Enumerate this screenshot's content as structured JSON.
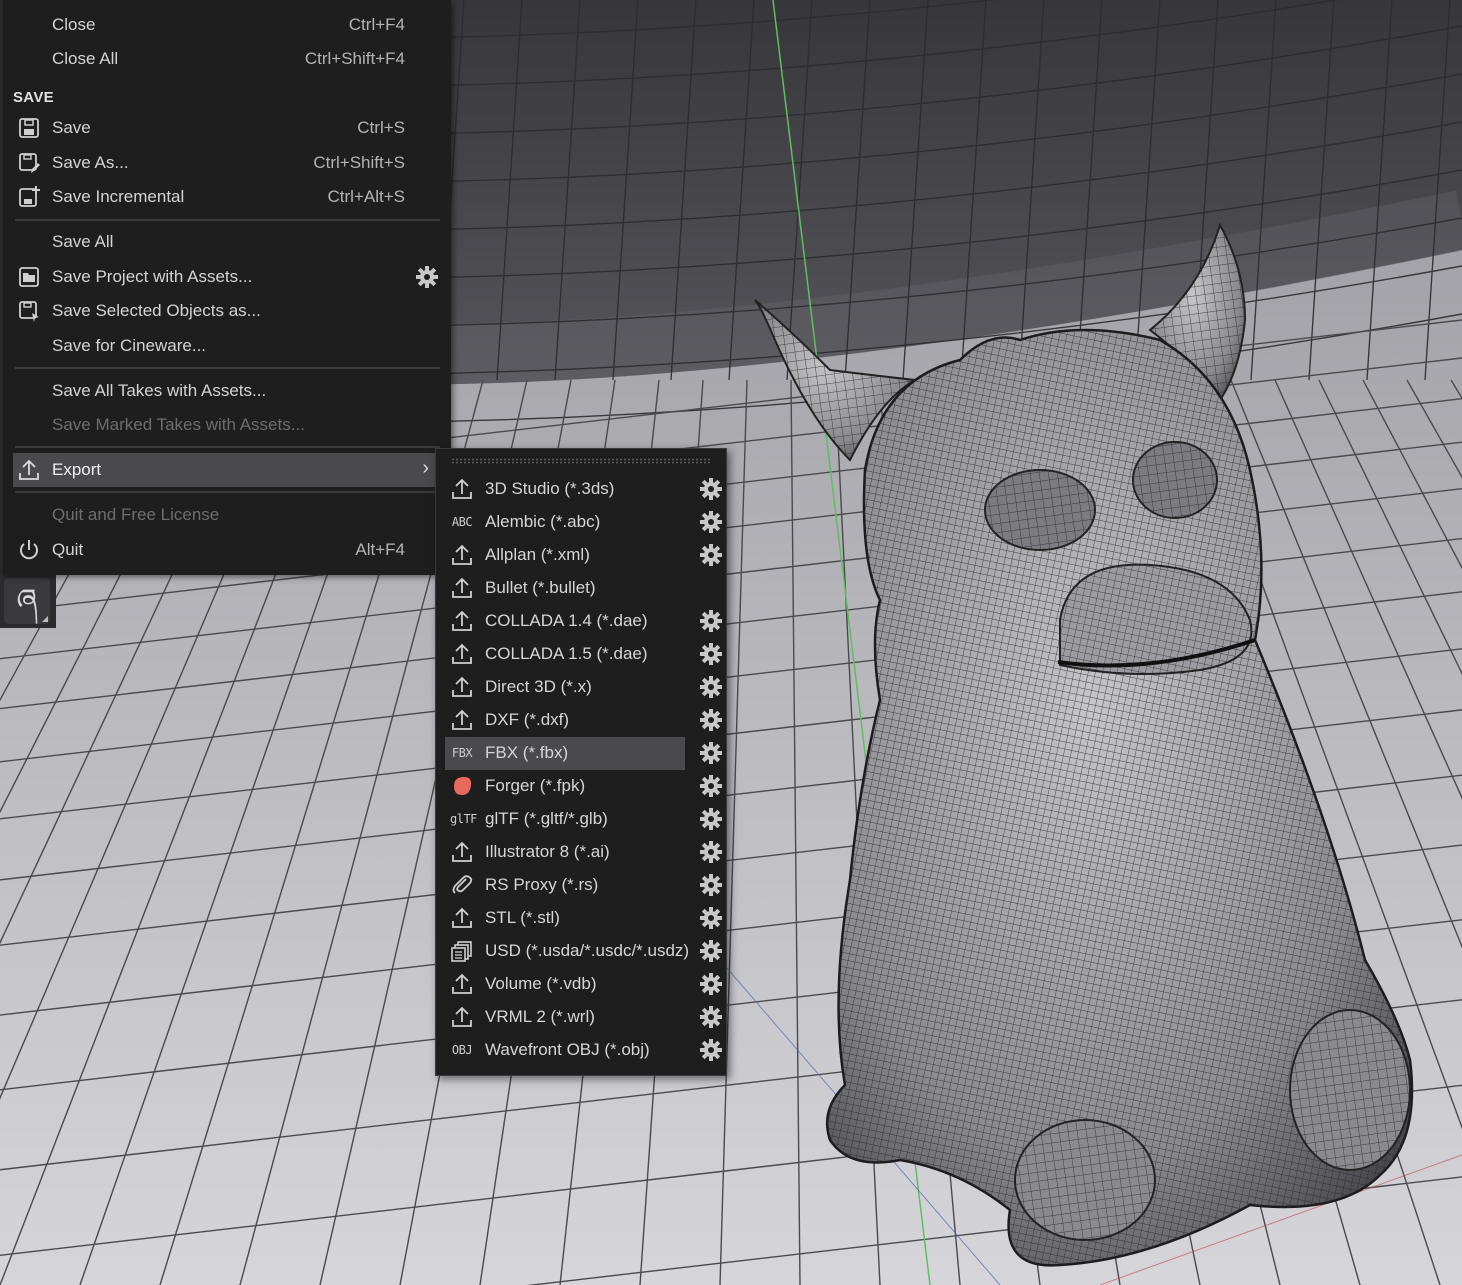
{
  "menu": {
    "top_items": [
      {
        "label": "Close",
        "shortcut": "Ctrl+F4"
      },
      {
        "label": "Close All",
        "shortcut": "Ctrl+Shift+F4"
      }
    ],
    "save_section_title": "SAVE",
    "save_items": [
      {
        "label": "Save",
        "shortcut": "Ctrl+S",
        "icon": "save-icon"
      },
      {
        "label": "Save As...",
        "shortcut": "Ctrl+Shift+S",
        "icon": "save-as-icon"
      },
      {
        "label": "Save Incremental",
        "shortcut": "Ctrl+Alt+S",
        "icon": "save-incremental-icon"
      }
    ],
    "save_all": "Save All",
    "save_project_assets": "Save Project with Assets...",
    "save_selected_objects": "Save Selected Objects as...",
    "save_for_cineware": "Save for Cineware...",
    "save_all_takes": "Save All Takes with Assets...",
    "save_marked_takes": "Save Marked Takes with Assets...",
    "export": "Export",
    "quit_free_license": "Quit and Free License",
    "quit": "Quit",
    "quit_shortcut": "Alt+F4"
  },
  "export_submenu": {
    "highlighted_index": 8,
    "items": [
      {
        "label": "3D Studio (*.3ds)",
        "icon": "export-icon",
        "has_settings": true
      },
      {
        "label": "Alembic (*.abc)",
        "icon": "ABC",
        "has_settings": true
      },
      {
        "label": "Allplan (*.xml)",
        "icon": "export-icon",
        "has_settings": true
      },
      {
        "label": "Bullet (*.bullet)",
        "icon": "export-icon",
        "has_settings": false
      },
      {
        "label": "COLLADA 1.4 (*.dae)",
        "icon": "export-icon",
        "has_settings": true
      },
      {
        "label": "COLLADA 1.5 (*.dae)",
        "icon": "export-icon",
        "has_settings": true
      },
      {
        "label": "Direct 3D (*.x)",
        "icon": "export-icon",
        "has_settings": true
      },
      {
        "label": "DXF (*.dxf)",
        "icon": "export-icon",
        "has_settings": true
      },
      {
        "label": "FBX (*.fbx)",
        "icon": "FBX",
        "has_settings": true
      },
      {
        "label": "Forger (*.fpk)",
        "icon": "forger-icon",
        "has_settings": true
      },
      {
        "label": "glTF (*.gltf/*.glb)",
        "icon": "glTF",
        "has_settings": true
      },
      {
        "label": "Illustrator 8 (*.ai)",
        "icon": "export-icon",
        "has_settings": true
      },
      {
        "label": "RS Proxy (*.rs)",
        "icon": "paperclip-icon",
        "has_settings": true
      },
      {
        "label": "STL (*.stl)",
        "icon": "export-icon",
        "has_settings": true
      },
      {
        "label": "USD (*.usda/*.usdc/*.usdz)",
        "icon": "usd-icon",
        "has_settings": true
      },
      {
        "label": "Volume (*.vdb)",
        "icon": "export-icon",
        "has_settings": true
      },
      {
        "label": "VRML 2 (*.wrl)",
        "icon": "export-icon",
        "has_settings": true
      },
      {
        "label": "Wavefront OBJ (*.obj)",
        "icon": "OBJ",
        "has_settings": true
      }
    ]
  },
  "colors": {
    "menu_bg": "#1e1e1f",
    "highlight": "#4a4a4d",
    "forger_icon": "#e86a5e",
    "axis_green": "#5fbf5f"
  }
}
